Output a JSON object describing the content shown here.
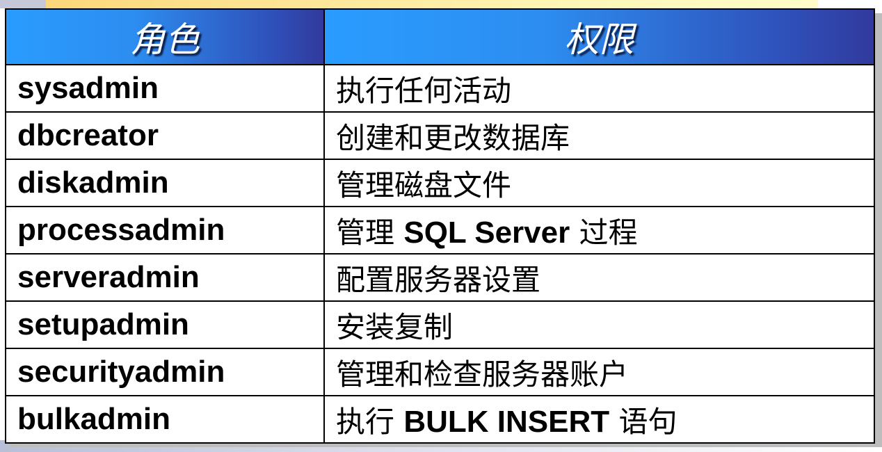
{
  "table": {
    "headers": [
      "角色",
      "权限"
    ],
    "rows": [
      {
        "role": "sysadmin",
        "permission": "执行任何活动"
      },
      {
        "role": "dbcreator",
        "permission": "创建和更改数据库"
      },
      {
        "role": "diskadmin",
        "permission": "管理磁盘文件"
      },
      {
        "role": "processadmin",
        "permission": "管理 SQL Server 过程"
      },
      {
        "role": "serveradmin",
        "permission": "配置服务器设置"
      },
      {
        "role": "setupadmin",
        "permission": "安装复制"
      },
      {
        "role": "securityadmin",
        "permission": "管理和检查服务器账户"
      },
      {
        "role": "bulkadmin",
        "permission": "执行 BULK INSERT 语句"
      }
    ]
  }
}
